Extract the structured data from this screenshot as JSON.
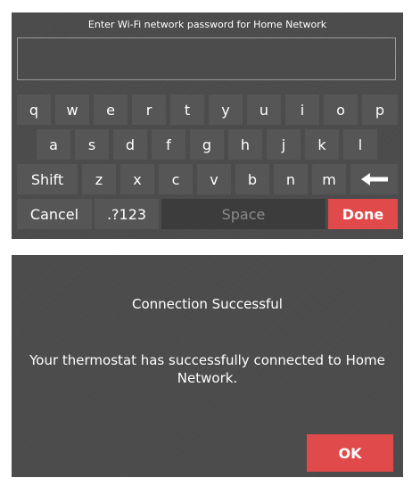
{
  "password_screen": {
    "prompt": "Enter Wi-Fi network password for Home Network",
    "password_value": "",
    "keyboard": {
      "row1": [
        "q",
        "w",
        "e",
        "r",
        "t",
        "y",
        "u",
        "i",
        "o",
        "p"
      ],
      "row2": [
        "a",
        "s",
        "d",
        "f",
        "g",
        "h",
        "j",
        "k",
        "l"
      ],
      "row3": [
        "z",
        "x",
        "c",
        "v",
        "b",
        "n",
        "m"
      ],
      "shift_label": "Shift",
      "backspace_icon": "left-arrow-icon",
      "cancel_label": "Cancel",
      "numbers_label": ".?123",
      "space_label": "Space",
      "done_label": "Done"
    }
  },
  "success_screen": {
    "title": "Connection Successful",
    "message": "Your thermostat has successfully connected to Home Network.",
    "ok_label": "OK"
  },
  "colors": {
    "panel": "#4a4a4a",
    "key": "#565656",
    "accent": "#e14a4a"
  }
}
